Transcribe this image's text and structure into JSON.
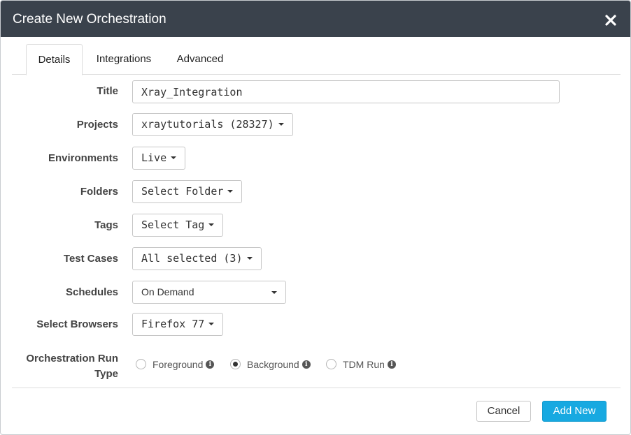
{
  "dialog": {
    "title": "Create New Orchestration",
    "close_glyph": "✖"
  },
  "tabs": [
    {
      "label": "Details",
      "active": true
    },
    {
      "label": "Integrations",
      "active": false
    },
    {
      "label": "Advanced",
      "active": false
    }
  ],
  "form": {
    "title": {
      "label": "Title",
      "value": "Xray_Integration"
    },
    "projects": {
      "label": "Projects",
      "value": "xraytutorials (28327)"
    },
    "environments": {
      "label": "Environments",
      "value": "Live"
    },
    "folders": {
      "label": "Folders",
      "value": "Select Folder"
    },
    "tags": {
      "label": "Tags",
      "value": "Select Tag"
    },
    "test_cases": {
      "label": "Test Cases",
      "value": "All selected (3)"
    },
    "schedules": {
      "label": "Schedules",
      "value": "On Demand"
    },
    "browsers": {
      "label": "Select Browsers",
      "value": "Firefox 77"
    },
    "run_type": {
      "label_line1": "Orchestration Run",
      "label_line2": "Type",
      "options": [
        {
          "label": "Foreground",
          "checked": false
        },
        {
          "label": "Background",
          "checked": true
        },
        {
          "label": "TDM Run",
          "checked": false
        }
      ]
    }
  },
  "footer": {
    "cancel_label": "Cancel",
    "add_label": "Add New"
  },
  "colors": {
    "header_bg": "#3a424c",
    "primary_button": "#17a9e1"
  }
}
